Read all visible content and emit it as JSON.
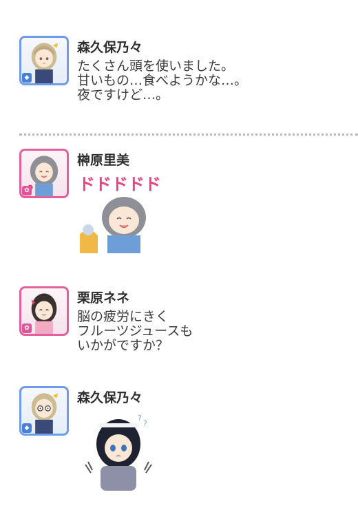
{
  "messages": [
    {
      "author": "森久保乃々",
      "avatar": "morikubo-nono-avatar",
      "lines": [
        "たくさん頭を使いました。",
        "甘いもの…食べようかな…。",
        "夜ですけど…。"
      ]
    },
    {
      "author": "榊原里美",
      "avatar": "sakakibara-satomi-avatar",
      "sticker_text": "ドドドドド"
    },
    {
      "author": "栗原ネネ",
      "avatar": "kurihara-nene-avatar",
      "lines": [
        "脳の疲労にきく",
        "フルーツジュースも",
        "いかがですか？"
      ]
    },
    {
      "author": "森久保乃々",
      "avatar": "morikubo-nono-avatar",
      "sticker_text": ""
    }
  ],
  "colors": {
    "cool_frame": "#6f9be8",
    "cute_frame": "#e4609b",
    "sticker_text": "#e8437a"
  }
}
